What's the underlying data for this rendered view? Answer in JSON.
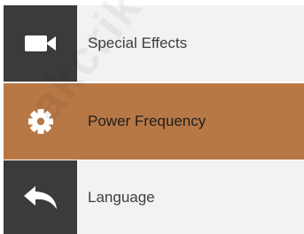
{
  "menu": {
    "items": [
      {
        "label": "Special Effects",
        "icon": "video-camera-icon",
        "selected": false
      },
      {
        "label": "Power Frequency",
        "icon": "gear-icon",
        "selected": true
      },
      {
        "label": "Language",
        "icon": "back-arrow-icon",
        "selected": false
      }
    ]
  },
  "watermark": {
    "text": "akcrik"
  },
  "colors": {
    "icon_column": "#3b3b3b",
    "row_background": "#f2f2f2",
    "selected_accent": "#b87845",
    "icon_color": "#ffffff"
  }
}
